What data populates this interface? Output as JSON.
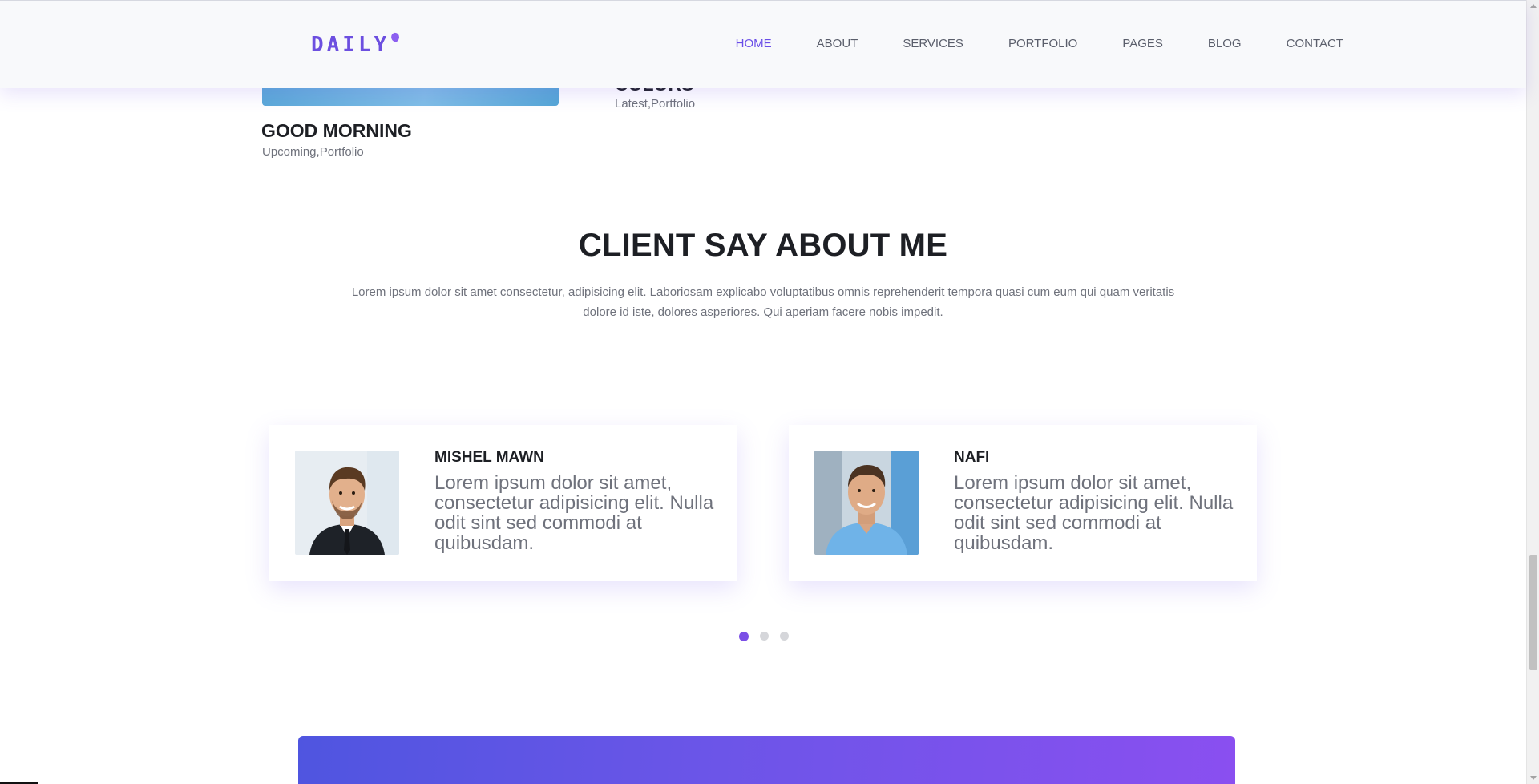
{
  "header": {
    "logo": "DAILY",
    "nav": [
      {
        "label": "HOME",
        "active": true
      },
      {
        "label": "ABOUT",
        "active": false
      },
      {
        "label": "SERVICES",
        "active": false
      },
      {
        "label": "PORTFOLIO",
        "active": false
      },
      {
        "label": "PAGES",
        "active": false
      },
      {
        "label": "BLOG",
        "active": false
      },
      {
        "label": "CONTACT",
        "active": false
      }
    ]
  },
  "portfolio": {
    "items": [
      {
        "title": "GOOD MORNING",
        "categories": "Upcoming,Portfolio"
      },
      {
        "title": "COLORS",
        "categories": "Latest,Portfolio"
      }
    ]
  },
  "testimonials": {
    "title": "CLIENT SAY ABOUT ME",
    "description": "Lorem ipsum dolor sit amet consectetur, adipisicing elit. Laboriosam explicabo voluptatibus omnis reprehenderit tempora quasi cum eum qui quam veritatis dolore id iste, dolores asperiores. Qui aperiam facere nobis impedit.",
    "cards": [
      {
        "name": "MISHEL MAWN",
        "text": "Lorem ipsum dolor sit amet, consectetur adipisicing elit. Nulla odit sint sed commodi at quibusdam."
      },
      {
        "name": "NAFI",
        "text": "Lorem ipsum dolor sit amet, consectetur adipisicing elit. Nulla odit sint sed commodi at quibusdam."
      }
    ],
    "carousel": {
      "pages": 3,
      "active_index": 0
    }
  },
  "colors": {
    "accent": "#6a4ee8",
    "banner_start": "#4f55e0",
    "banner_end": "#8a4ff0"
  }
}
